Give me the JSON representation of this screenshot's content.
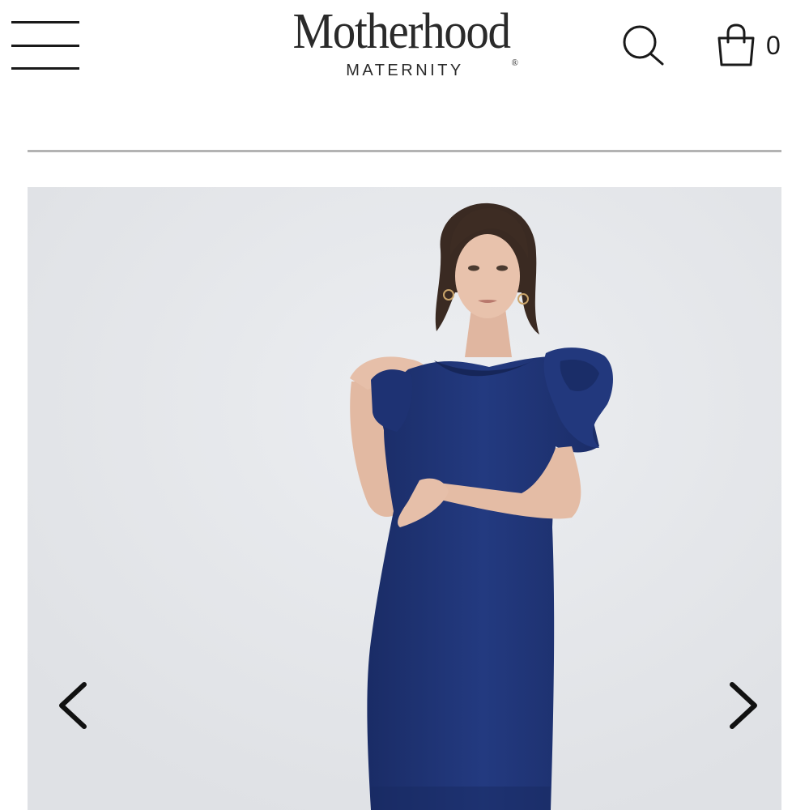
{
  "header": {
    "logo_main": "Motherhood",
    "logo_registered": "®",
    "logo_sub": "MATERNITY",
    "cart_count": "0",
    "icons": {
      "menu": "hamburger-menu-icon",
      "search": "search-icon",
      "cart": "shopping-bag-icon"
    }
  },
  "carousel": {
    "image_alt": "Model wearing navy short sleeve maternity shift dress with rosette shoulder detail",
    "prev_icon": "chevron-left-icon",
    "next_icon": "chevron-right-icon"
  },
  "colors": {
    "text": "#1a1a1a",
    "divider": "#b3b3b3",
    "image_background": "#e4e5e9",
    "dress_navy": "#1f3476"
  }
}
